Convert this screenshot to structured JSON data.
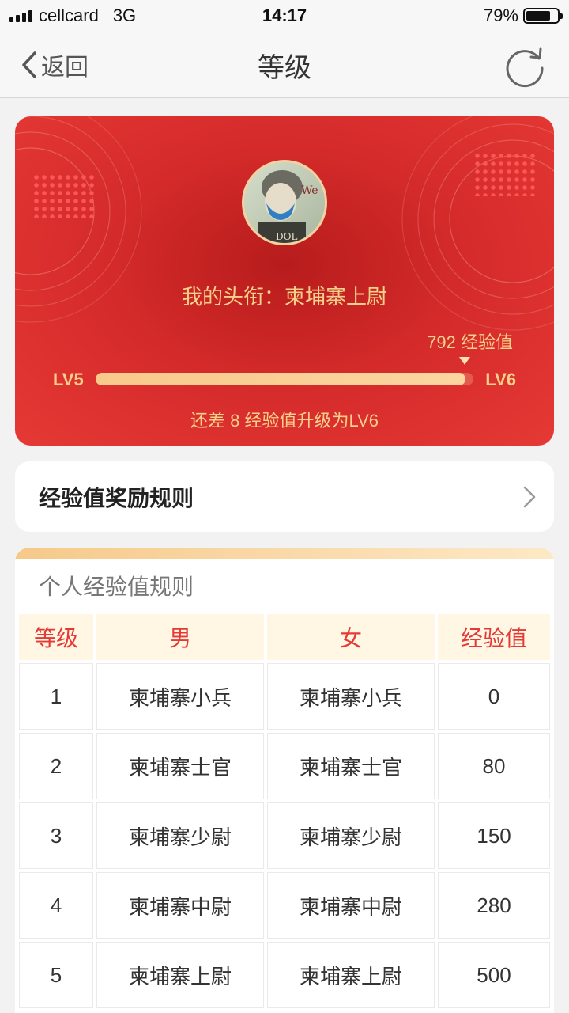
{
  "status_bar": {
    "carrier": "cellcard",
    "network": "3G",
    "time": "14:17",
    "battery_percent": "79%",
    "battery_level": 0.79
  },
  "nav": {
    "back_label": "返回",
    "title": "等级",
    "refresh_icon": "refresh-icon"
  },
  "level_card": {
    "title_line": "我的头衔：柬埔寨上尉",
    "current_exp": "792 经验值",
    "lv_from": "LV5",
    "lv_to": "LV6",
    "progress": 0.98,
    "remaining_line": "还差 8 经验值升级为LV6"
  },
  "reward_rules": {
    "label": "经验值奖励规则"
  },
  "table": {
    "title": "个人经验值规则",
    "headers": [
      "等级",
      "男",
      "女",
      "经验值"
    ],
    "rows": [
      [
        "1",
        "柬埔寨小兵",
        "柬埔寨小兵",
        "0"
      ],
      [
        "2",
        "柬埔寨士官",
        "柬埔寨士官",
        "80"
      ],
      [
        "3",
        "柬埔寨少尉",
        "柬埔寨少尉",
        "150"
      ],
      [
        "4",
        "柬埔寨中尉",
        "柬埔寨中尉",
        "280"
      ],
      [
        "5",
        "柬埔寨上尉",
        "柬埔寨上尉",
        "500"
      ]
    ]
  },
  "colors": {
    "card_red": "#e53935",
    "accent_gold": "#f7d08a",
    "header_red_text": "#e53935"
  }
}
